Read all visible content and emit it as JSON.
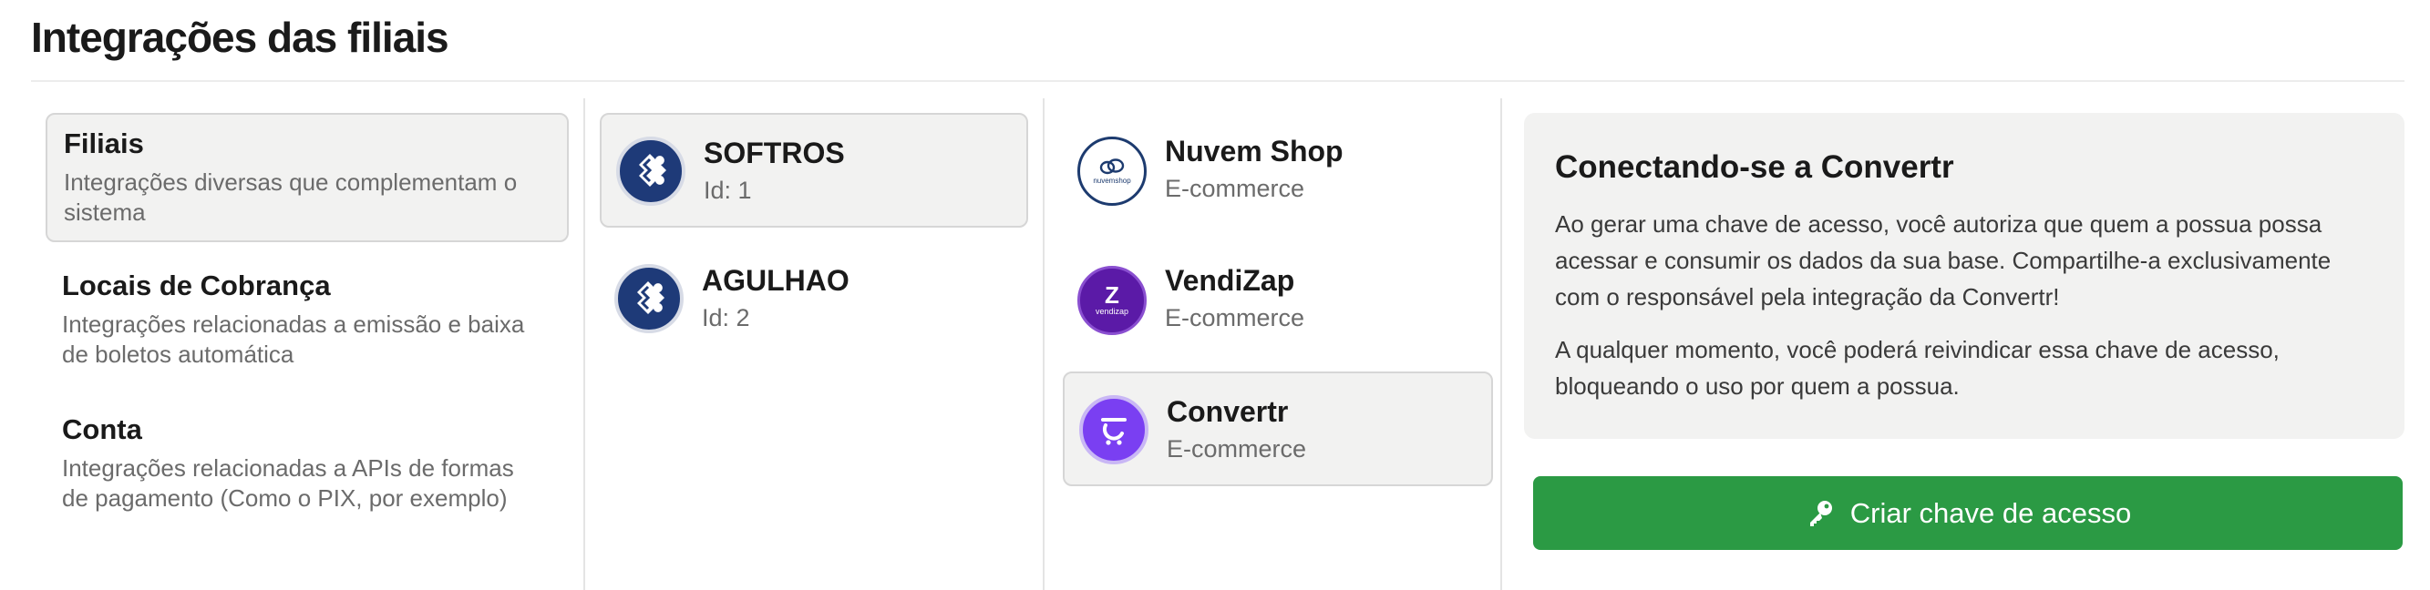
{
  "page": {
    "title": "Integrações das filiais"
  },
  "categories": [
    {
      "title": "Filiais",
      "description": "Integrações diversas que complementam o sistema",
      "selected": true
    },
    {
      "title": "Locais de Cobrança",
      "description": "Integrações relacionadas a emissão e baixa de boletos automática",
      "selected": false
    },
    {
      "title": "Conta",
      "description": "Integrações relacionadas a APIs de formas de pagamento (Como o PIX, por exemplo)",
      "selected": false
    }
  ],
  "branches": [
    {
      "name": "SOFTROS",
      "id_label": "Id: 1",
      "selected": true,
      "icon": "puzzle-icon"
    },
    {
      "name": "AGULHAO",
      "id_label": "Id: 2",
      "selected": false,
      "icon": "puzzle-icon"
    }
  ],
  "integrations": [
    {
      "name": "Nuvem Shop",
      "type": "E-commerce",
      "logo_text": "nuvemshop",
      "selected": false
    },
    {
      "name": "VendiZap",
      "type": "E-commerce",
      "logo_text": "vendizap",
      "selected": false
    },
    {
      "name": "Convertr",
      "type": "E-commerce",
      "selected": true
    }
  ],
  "info": {
    "title": "Conectando-se a Convertr",
    "paragraph1": "Ao gerar uma chave de acesso, você autoriza que quem a possua possa acessar e consumir os dados da sua base. Compartilhe-a exclusivamente com o responsável pela integração da Convertr!",
    "paragraph2": "A qualquer momento, você poderá reivindicar essa chave de acesso, bloqueando o uso por quem a possua."
  },
  "action": {
    "label": "Criar chave de acesso",
    "icon": "key-icon"
  },
  "colors": {
    "accent_green": "#2b9a44",
    "softros_blue": "#1e3a78",
    "convertr_purple": "#7a3ff2",
    "vendizap_purple": "#5b1aa7"
  }
}
